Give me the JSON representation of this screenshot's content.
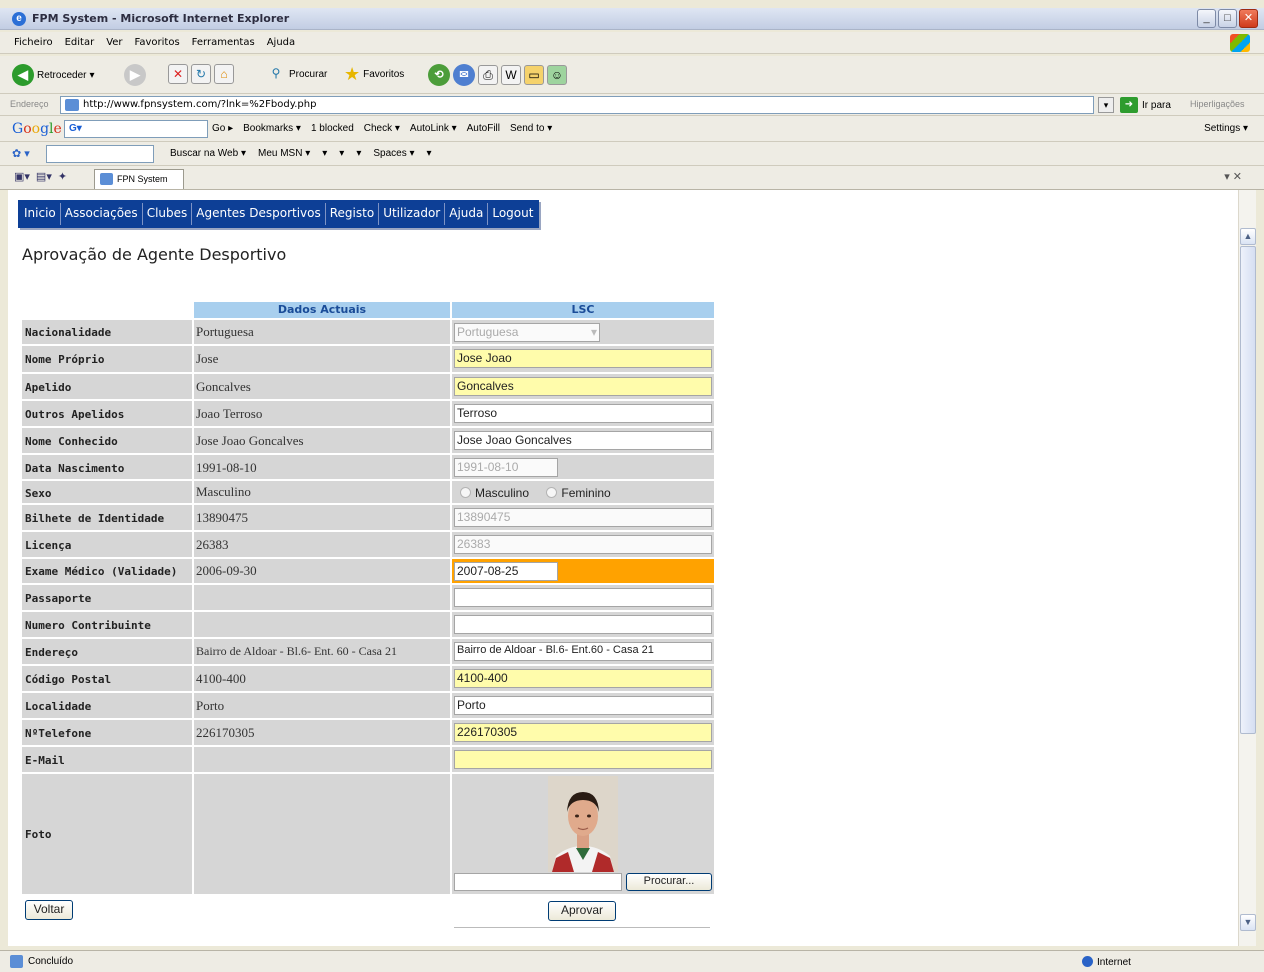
{
  "window": {
    "title": "FPM System - Microsoft Internet Explorer",
    "buttons": {
      "minimize": "_",
      "maximize": "□",
      "close": "✕"
    }
  },
  "menu": [
    "Ficheiro",
    "Editar",
    "Ver",
    "Favoritos",
    "Ferramentas",
    "Ajuda"
  ],
  "toolbar": {
    "back": "Retroceder",
    "search": "Procurar",
    "favorites": "Favoritos"
  },
  "address": {
    "label": "Endereço",
    "url": "http://www.fpnsystem.com/?lnk=%2Fbody.php",
    "go": "Ir para",
    "links": "Hiperligações"
  },
  "google_bar": {
    "logo": [
      "G",
      "o",
      "o",
      "g",
      "l",
      "e"
    ],
    "query": "G▾",
    "items": [
      "Go ▸",
      "Bookmarks ▾",
      "1 blocked",
      "Check ▾",
      "AutoLink ▾",
      "AutoFill",
      "Send to ▾"
    ],
    "settings": "Settings ▾"
  },
  "msn_bar": {
    "items": [
      "Buscar na Web ▾",
      "Meu MSN ▾",
      "▾",
      "▾",
      "▾",
      "Spaces ▾",
      "▾"
    ]
  },
  "tab": {
    "title": "FPN System"
  },
  "nav": [
    "Inicio",
    "Associações",
    "Clubes",
    "Agentes Desportivos",
    "Registo",
    "Utilizador",
    "Ajuda",
    "Logout"
  ],
  "page_title": "Aprovação de Agente Desportivo",
  "columns": {
    "current": "Dados Actuais",
    "lsc": "LSC"
  },
  "rows": [
    {
      "label": "Nacionalidade",
      "current": "Portuguesa",
      "lsc": "Portuguesa"
    },
    {
      "label": "Nome Próprio",
      "current": "Jose",
      "lsc": "Jose Joao"
    },
    {
      "label": "Apelido",
      "current": "Goncalves",
      "lsc": "Goncalves"
    },
    {
      "label": "Outros Apelidos",
      "current": "Joao Terroso",
      "lsc": "Terroso"
    },
    {
      "label": "Nome Conhecido",
      "current": "Jose Joao Goncalves",
      "lsc": "Jose Joao Goncalves"
    },
    {
      "label": "Data Nascimento",
      "current": "1991-08-10",
      "lsc": "1991-08-10"
    },
    {
      "label": "Sexo",
      "current": "Masculino",
      "lsc_male": "Masculino",
      "lsc_female": "Feminino"
    },
    {
      "label": "Bilhete de Identidade",
      "current": "13890475",
      "lsc": "13890475"
    },
    {
      "label": "Licença",
      "current": "26383",
      "lsc": "26383"
    },
    {
      "label": "Exame Médico (Validade)",
      "current": "2006-09-30",
      "lsc": "2007-08-25"
    },
    {
      "label": "Passaporte",
      "current": "",
      "lsc": ""
    },
    {
      "label": "Numero Contribuinte",
      "current": "",
      "lsc": ""
    },
    {
      "label": "Endereço",
      "current": "Bairro de Aldoar - Bl.6- Ent. 60 - Casa 21",
      "lsc": "Bairro de Aldoar - Bl.6- Ent.60 - Casa 21"
    },
    {
      "label": "Código Postal",
      "current": "4100-400",
      "lsc": "4100-400"
    },
    {
      "label": "Localidade",
      "current": "Porto",
      "lsc": "Porto"
    },
    {
      "label": "NºTelefone",
      "current": "226170305",
      "lsc": "226170305"
    },
    {
      "label": "E-Mail",
      "current": "",
      "lsc": ""
    },
    {
      "label": "Foto"
    }
  ],
  "buttons": {
    "browse": "Procurar...",
    "back": "Voltar",
    "approve": "Aprovar"
  },
  "status": {
    "text": "Concluído",
    "zone": "Internet"
  },
  "colors": {
    "nav": "#0d3f96",
    "header": "#a8cfee",
    "changed": "#fffcab",
    "expired": "#ffa200"
  }
}
